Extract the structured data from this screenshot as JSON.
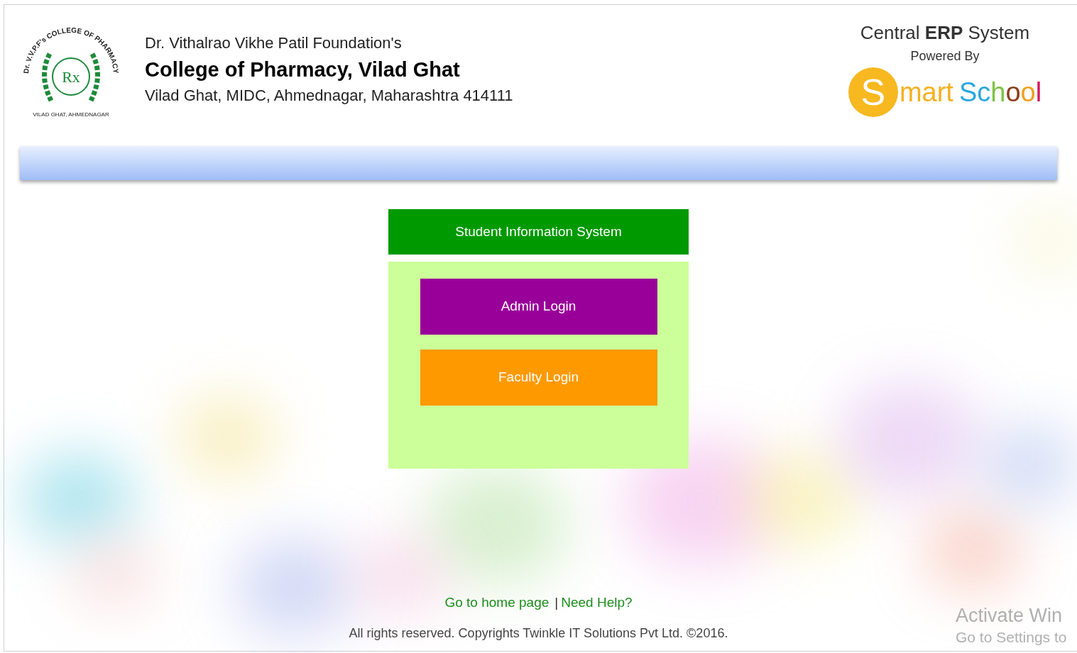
{
  "header": {
    "seal": {
      "top_text": "Dr. V.V.P.F's COLLEGE OF PHARMACY",
      "bottom_text": "VILAD GHAT, AHMEDNAGAR",
      "monogram": "Rx"
    },
    "foundation": "Dr. Vithalrao Vikhe Patil Foundation's",
    "college": "College of Pharmacy, Vilad Ghat",
    "address": "Vilad Ghat, MIDC, Ahmednagar, Maharashtra 414111",
    "erp_title": "Central **ERP** System",
    "powered_by": "Powered By",
    "brand": {
      "initial": "S",
      "first": "mart",
      "second": "School"
    }
  },
  "panel": {
    "title": "Student Information System",
    "buttons": [
      {
        "label": "Admin Login",
        "color": "#990099"
      },
      {
        "label": "Faculty Login",
        "color": "#ff9900"
      }
    ]
  },
  "footer": {
    "links": [
      "Go to home page",
      "Need Help?"
    ],
    "separator": "|",
    "copyright": "All rights reserved. Copyrights Twinkle IT Solutions Pvt Ltd. ©2016."
  },
  "os_notice": [
    "Activate Win",
    "Go to Settings to"
  ]
}
